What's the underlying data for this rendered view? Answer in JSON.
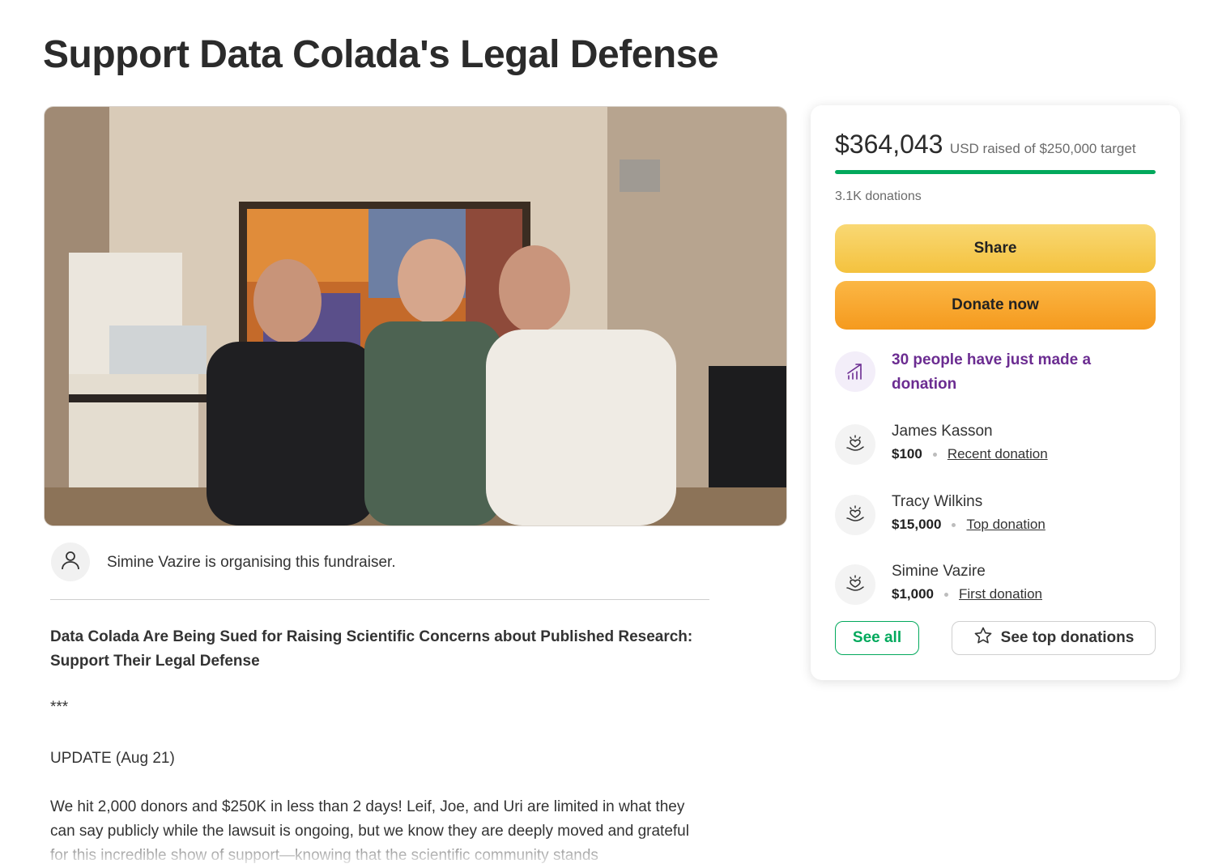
{
  "page": {
    "title": "Support Data Colada's Legal Defense"
  },
  "organiser": {
    "text": "Simine Vazire is organising this fundraiser."
  },
  "story": {
    "heading": "Data Colada Are Being Sued for Raising Scientific Concerns about Published Research: Support Their Legal Defense",
    "separator": "***",
    "update": "UPDATE (Aug 21)",
    "body": "We hit 2,000 donors and $250K in less than 2 days! Leif, Joe, and Uri are limited in what they can say publicly while the lawsuit is ongoing, but we know they are deeply moved and grateful for this incredible show of support—knowing that the scientific community stands"
  },
  "card": {
    "raised_amount": "$364,043",
    "raised_suffix": "USD raised of $250,000 target",
    "progress_fraction": 1.0,
    "donations_count": "3.1K donations",
    "share_label": "Share",
    "donate_label": "Donate now",
    "trend_text": "30 people have just made a donation",
    "donors": [
      {
        "name": "James Kasson",
        "amount": "$100",
        "tag": "Recent donation"
      },
      {
        "name": "Tracy Wilkins",
        "amount": "$15,000",
        "tag": "Top donation"
      },
      {
        "name": "Simine Vazire",
        "amount": "$1,000",
        "tag": "First donation"
      }
    ],
    "see_all_label": "See all",
    "see_top_label": "See top donations"
  },
  "colors": {
    "progress_green": "#02a95c",
    "share_yellow": "#f4c23e",
    "donate_orange": "#f59a1e",
    "trend_purple": "#6b2c91"
  },
  "icons": {
    "organiser": "person-icon",
    "trend": "trend-up-icon",
    "donor": "heart-hand-icon",
    "see_top": "star-icon"
  }
}
